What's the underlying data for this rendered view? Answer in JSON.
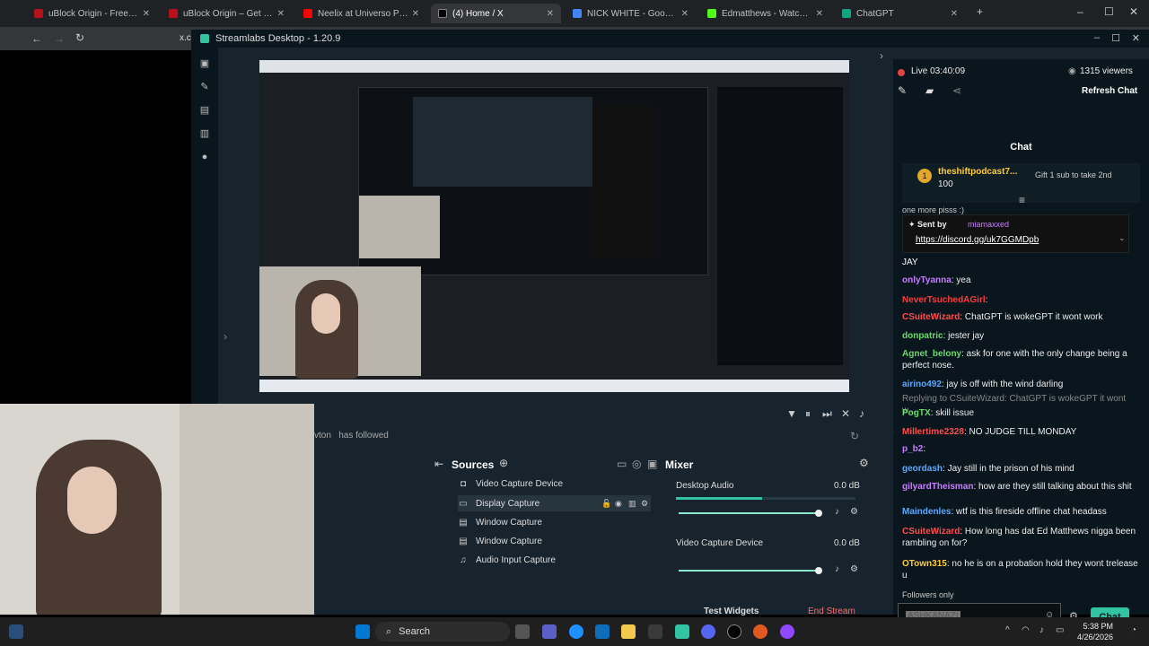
{
  "browser": {
    "tabs": [
      {
        "label": "uBlock Origin - Free, open-sour",
        "color": "#b5121b"
      },
      {
        "label": "uBlock Origin – Get this Extens",
        "color": "#b5121b"
      },
      {
        "label": "Neelix at Universo Paralello - Yo",
        "color": "#ff0000"
      },
      {
        "label": "(4) Home / X",
        "color": "#000000"
      },
      {
        "label": "NICK WHITE - Google Search",
        "color": "#4285f4"
      },
      {
        "label": "Edmatthews - Watch clips on K",
        "color": "#53fc18"
      },
      {
        "label": "ChatGPT",
        "color": "#10a37f"
      }
    ],
    "address": "x.co"
  },
  "streamlabs": {
    "title": "Streamlabs Desktop - 1.20.9",
    "feed_name": "vton",
    "feed_text": "has followed",
    "sources_title": "Sources",
    "sources": [
      {
        "label": "Video Capture Device",
        "icon": "camera-icon"
      },
      {
        "label": "Display Capture",
        "icon": "monitor-icon"
      },
      {
        "label": "Window Capture",
        "icon": "window-icon"
      },
      {
        "label": "Window Capture",
        "icon": "window-icon"
      },
      {
        "label": "Audio Input Capture",
        "icon": "mic-icon"
      }
    ],
    "mixer_title": "Mixer",
    "mixer": [
      {
        "label": "Desktop Audio",
        "db": "0.0 dB",
        "level": 0.9
      },
      {
        "label": "Video Capture Device",
        "db": "0.0 dB",
        "level": 0.9
      }
    ],
    "footer": {
      "test_widgets": "Test Widgets",
      "end_stream": "End Stream"
    }
  },
  "chat": {
    "live": "Live 03:40:09",
    "viewers": "1315 viewers",
    "refresh": "Refresh Chat",
    "header": "Chat",
    "gift": {
      "user": "theshiftpodcast7...",
      "amount": "100",
      "note": "Gift 1 sub to take 2nd"
    },
    "partial": "one more pisss :)",
    "pinned": {
      "sent_by": "Sent by",
      "user": "miamaxxed",
      "link": "https://discord.gg/uk7GGMDpb"
    },
    "messages": [
      {
        "user": "",
        "text": "JAY",
        "color": "#ffffff"
      },
      {
        "user": "onlyTyanna",
        "text": ": yea",
        "color": "#c77dff"
      },
      {
        "user": "NeverTsuchedAGirl",
        "text": ":",
        "color": "#ff3b3b"
      },
      {
        "user": "CSuiteWizard",
        "text": ": ChatGPT is wokeGPT it wont work",
        "color": "#ff4d4d"
      },
      {
        "user": "donpatric",
        "text": ": jester jay",
        "color": "#6dd96d"
      },
      {
        "user": "Agnet_belony",
        "text": ": ask for one with the only change being a perfect nose.",
        "color": "#6dd96d"
      },
      {
        "user": "airino492",
        "text": ": jay is off with the wind darling",
        "color": "#5da8ff"
      },
      {
        "user": "",
        "text": "Replying to CSuiteWizard: ChatGPT is wokeGPT it wont w...",
        "color": "#888888"
      },
      {
        "user": "PogTX",
        "text": ": skill issue",
        "color": "#6dd96d"
      },
      {
        "user": "Millertime2328",
        "text": ": NO JUDGE TILL MONDAY",
        "color": "#ff4d4d"
      },
      {
        "user": "p_b2",
        "text": ":",
        "color": "#c77dff"
      },
      {
        "user": "geordash",
        "text": ": Jay still in the prison of his mind",
        "color": "#5da8ff"
      },
      {
        "user": "gilyardTheisman",
        "text": ": how are they still talking about this shit",
        "color": "#c77dff"
      },
      {
        "user": "Maindenles",
        "text": ": wtf is this fireside offline chat headass",
        "color": "#5da8ff"
      },
      {
        "user": "CSuiteWizard",
        "text": ": How long has dat Ed Matthews nigga been rambling on for?",
        "color": "#ff4d4d"
      },
      {
        "user": "OTown315",
        "text": ": no he is on a probation hold they wont trelease u",
        "color": "#ffcc33"
      }
    ],
    "followers_only": "Followers only",
    "input_value": "ASHKANAZI",
    "send": "Chat"
  },
  "taskbar": {
    "search": "Search",
    "time": "5:38 PM",
    "date": "4/26/2026"
  }
}
